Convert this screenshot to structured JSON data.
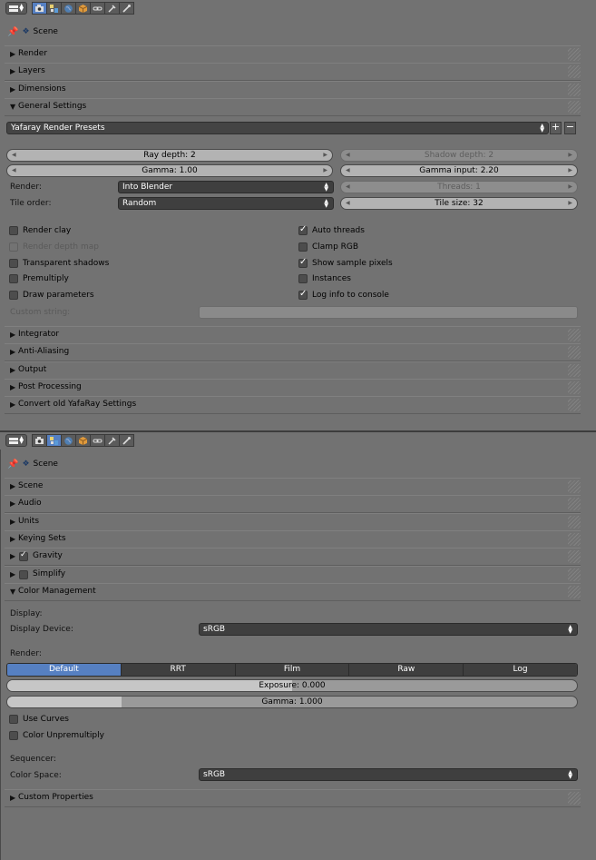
{
  "top_editor": {
    "path": "Scene",
    "panels": {
      "render": "Render",
      "layers": "Layers",
      "dimensions": "Dimensions",
      "general_settings": "General Settings",
      "integrator": "Integrator",
      "anti_aliasing": "Anti-Aliasing",
      "output": "Output",
      "post_processing": "Post Processing",
      "convert": "Convert old YafaRay Settings"
    },
    "presets": "Yafaray Render Presets",
    "preset_add": "+",
    "preset_remove": "−",
    "ray_depth": "Ray depth: 2",
    "shadow_depth": "Shadow depth: 2",
    "gamma": "Gamma: 1.00",
    "gamma_input": "Gamma input: 2.20",
    "render_label": "Render:",
    "render_value": "Into Blender",
    "threads": "Threads: 1",
    "tile_order_label": "Tile order:",
    "tile_order_value": "Random",
    "tile_size": "Tile size: 32",
    "checkboxes_left": [
      {
        "label": "Render clay",
        "checked": false,
        "enabled": true
      },
      {
        "label": "Render depth map",
        "checked": false,
        "enabled": false
      },
      {
        "label": "Transparent shadows",
        "checked": false,
        "enabled": true
      },
      {
        "label": "Premultiply",
        "checked": false,
        "enabled": true
      },
      {
        "label": "Draw parameters",
        "checked": false,
        "enabled": true
      }
    ],
    "checkboxes_right": [
      {
        "label": "Auto threads",
        "checked": true
      },
      {
        "label": "Clamp RGB",
        "checked": false
      },
      {
        "label": "Show sample pixels",
        "checked": true
      },
      {
        "label": "Instances",
        "checked": false
      },
      {
        "label": "Log info to console",
        "checked": true
      }
    ],
    "custom_string_label": "Custom string:",
    "custom_string_value": ""
  },
  "bottom_editor": {
    "path": "Scene",
    "panels": {
      "scene": "Scene",
      "audio": "Audio",
      "units": "Units",
      "keying_sets": "Keying Sets",
      "gravity": "Gravity",
      "simplify": "Simplify",
      "color_management": "Color Management",
      "custom_properties": "Custom Properties"
    },
    "gravity_enabled": true,
    "simplify_enabled": false,
    "display_heading": "Display:",
    "display_device_label": "Display Device:",
    "display_device_value": "sRGB",
    "render_heading": "Render:",
    "view_transforms": [
      "Default",
      "RRT",
      "Film",
      "Raw",
      "Log"
    ],
    "active_view_transform": "Default",
    "exposure": "Exposure: 0.000",
    "exposure_fraction": 0.5,
    "gamma": "Gamma: 1.000",
    "gamma_fraction": 0.2,
    "use_curves": "Use Curves",
    "color_unpremultiply": "Color Unpremultiply",
    "sequencer_heading": "Sequencer:",
    "color_space_label": "Color Space:",
    "color_space_value": "sRGB"
  },
  "colors": {
    "background": "#727272",
    "accent_active": "#5680c2",
    "dropdown_bg": "#3f3f3f"
  },
  "icons": [
    "editor-type-icon",
    "render-icon",
    "scene-icon",
    "world-icon",
    "object-icon",
    "constraints-icon",
    "modifiers-icon",
    "data-icon",
    "pin-icon"
  ]
}
